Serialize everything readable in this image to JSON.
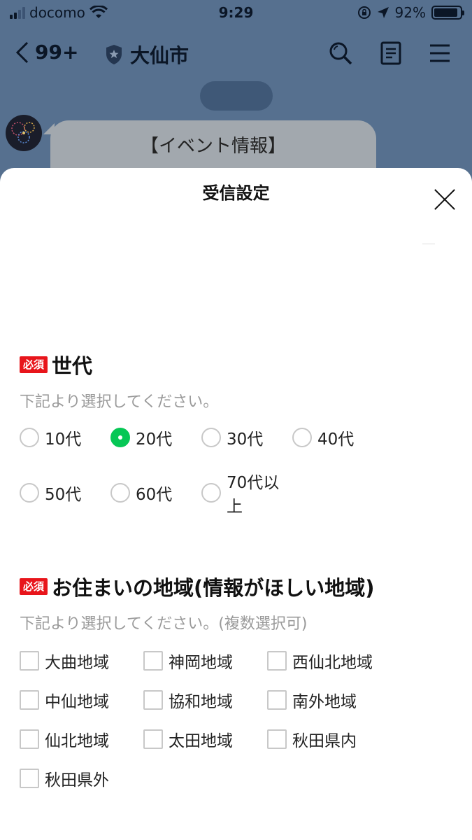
{
  "status_bar": {
    "carrier": "docomo",
    "time": "9:29",
    "battery": "92%",
    "battery_level": 0.92
  },
  "nav": {
    "back_count": "99+",
    "title": "大仙市",
    "icons": [
      "back-icon",
      "shield-icon",
      "search-icon",
      "notes-icon",
      "menu-icon"
    ]
  },
  "chat": {
    "bubble_text": "【イベント情報】"
  },
  "sheet": {
    "title": "受信設定",
    "required_badge": "必須",
    "age": {
      "title": "世代",
      "note": "下記より選択してください。",
      "options": [
        "10代",
        "20代",
        "30代",
        "40代",
        "50代",
        "60代",
        "70代以上"
      ],
      "selected": "20代"
    },
    "region": {
      "title": "お住まいの地域(情報がほしい地域)",
      "note": "下記より選択してください。(複数選択可)",
      "options": [
        "大曲地域",
        "神岡地域",
        "西仙北地域",
        "中仙地域",
        "協和地域",
        "南外地域",
        "仙北地域",
        "太田地域",
        "秋田県内",
        "秋田県外"
      ]
    }
  },
  "colors": {
    "accent": "#06c755",
    "badge": "#e8151b",
    "chat_bg": "#56708f"
  }
}
